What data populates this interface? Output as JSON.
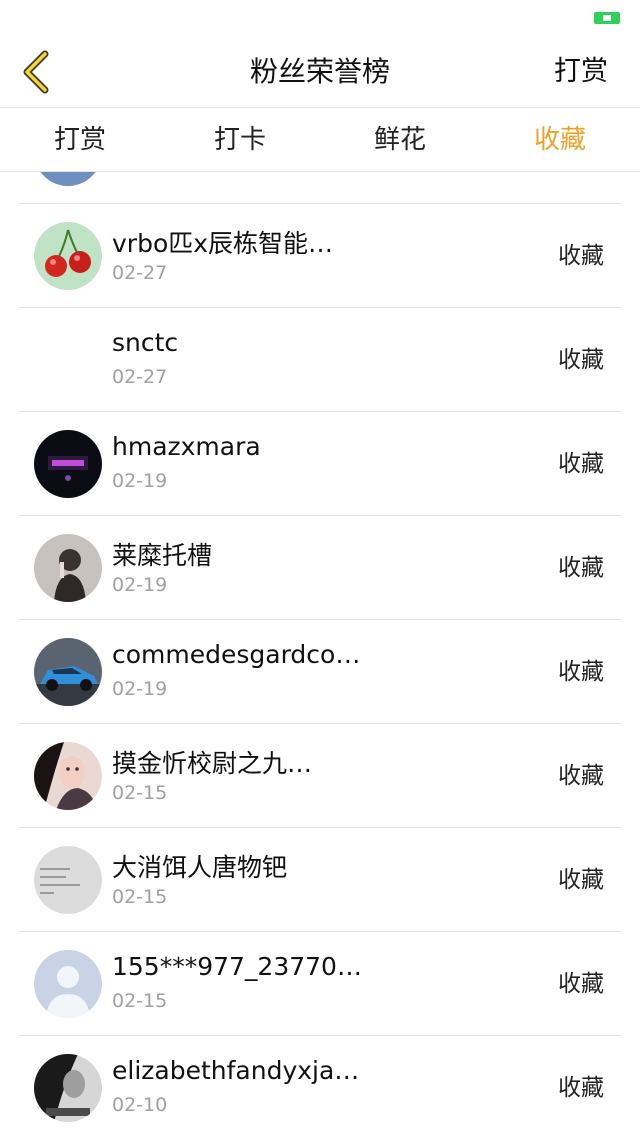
{
  "colors": {
    "accent": "#f0a12a",
    "battery": "#2fd15a",
    "back_arrow_fill": "#f6d233"
  },
  "nav": {
    "title": "粉丝荣誉榜",
    "action": "打赏",
    "back_icon": "chevron-left-icon"
  },
  "tabs": [
    {
      "label": "打赏",
      "active": false
    },
    {
      "label": "打卡",
      "active": false
    },
    {
      "label": "鲜花",
      "active": false
    },
    {
      "label": "收藏",
      "active": true
    }
  ],
  "list": {
    "rows": [
      {
        "name": "",
        "date": "",
        "action": "",
        "avatar": "blue-round-avatar"
      },
      {
        "name": "vrbo匹x辰栋智能…",
        "date": "02-27",
        "action": "收藏",
        "avatar": "cherry-avatar"
      },
      {
        "name": "snctc",
        "date": "02-27",
        "action": "收藏",
        "avatar": "blank-avatar"
      },
      {
        "name": "hmazxmara",
        "date": "02-19",
        "action": "收藏",
        "avatar": "dark-logo-avatar"
      },
      {
        "name": "莱糜托槽",
        "date": "02-19",
        "action": "收藏",
        "avatar": "portrait-avatar"
      },
      {
        "name": "commedesgardco…",
        "date": "02-19",
        "action": "收藏",
        "avatar": "blue-car-avatar"
      },
      {
        "name": "摸金忻校尉之九…",
        "date": "02-15",
        "action": "收藏",
        "avatar": "woman-photo-avatar"
      },
      {
        "name": "大消饵人唐物钯",
        "date": "02-15",
        "action": "收藏",
        "avatar": "text-image-avatar"
      },
      {
        "name": "155***977_23770…",
        "date": "02-15",
        "action": "收藏",
        "avatar": "default-user-avatar"
      },
      {
        "name": "elizabethfandyxja…",
        "date": "02-10",
        "action": "收藏",
        "avatar": "bw-photo-avatar"
      }
    ]
  }
}
